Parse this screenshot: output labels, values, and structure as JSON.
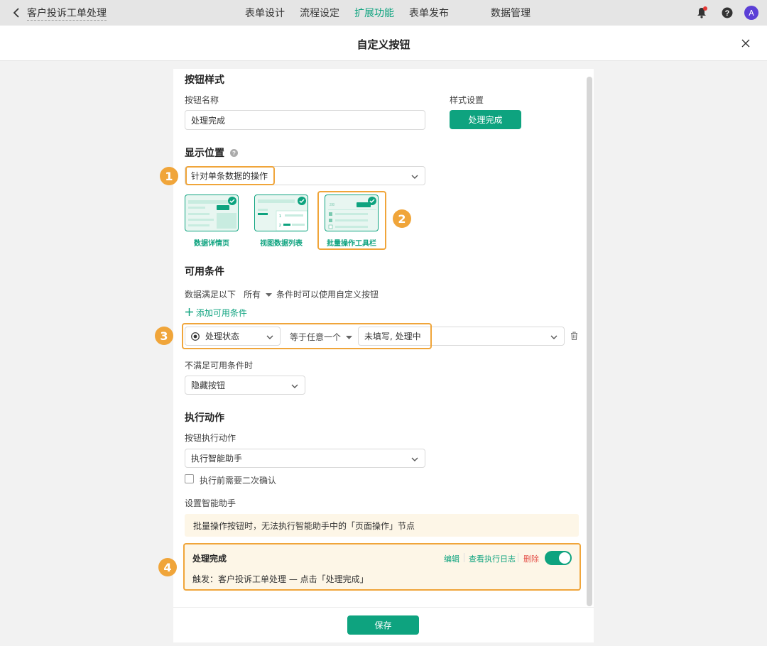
{
  "topbar": {
    "app_title": "客户投诉工单处理",
    "tabs": [
      "表单设计",
      "流程设定",
      "扩展功能",
      "表单发布",
      "数据管理"
    ],
    "active_tab": "扩展功能",
    "avatar_initial": "A"
  },
  "dialog": {
    "title": "自定义按钮"
  },
  "button_style": {
    "section_title": "按钮样式",
    "name_label": "按钮名称",
    "name_value": "处理完成",
    "style_label": "样式设置",
    "style_preview": "处理完成"
  },
  "display": {
    "section_title": "显示位置",
    "select_value": "针对单条数据的操作",
    "cards": [
      "数据详情页",
      "视图数据列表",
      "批量操作工具栏"
    ]
  },
  "conditions": {
    "section_title": "可用条件",
    "sentence_pre": "数据满足以下",
    "match_mode": "所有",
    "sentence_post": "条件时可以使用自定义按钮",
    "add_label": "添加可用条件",
    "field": "处理状态",
    "operator": "等于任意一个",
    "values": "未填写, 处理中",
    "unmet_label": "不满足可用条件时",
    "unmet_value": "隐藏按钮"
  },
  "action": {
    "section_title": "执行动作",
    "action_label": "按钮执行动作",
    "action_value": "执行智能助手",
    "confirm_label": "执行前需要二次确认",
    "assistant_label": "设置智能助手",
    "notice": "批量操作按钮时，无法执行智能助手中的「页面操作」节点",
    "assistant_name": "处理完成",
    "edit": "编辑",
    "log": "查看执行日志",
    "delete": "删除",
    "trigger": "触发：客户投诉工单处理 — 点击「处理完成」"
  },
  "footer": {
    "save": "保存"
  },
  "markers": [
    "1",
    "2",
    "3",
    "4"
  ],
  "colors": {
    "accent": "#0ea37f",
    "highlight": "#f0a53a",
    "notice_bg": "#fdf6e7",
    "delete": "#e5534b"
  }
}
